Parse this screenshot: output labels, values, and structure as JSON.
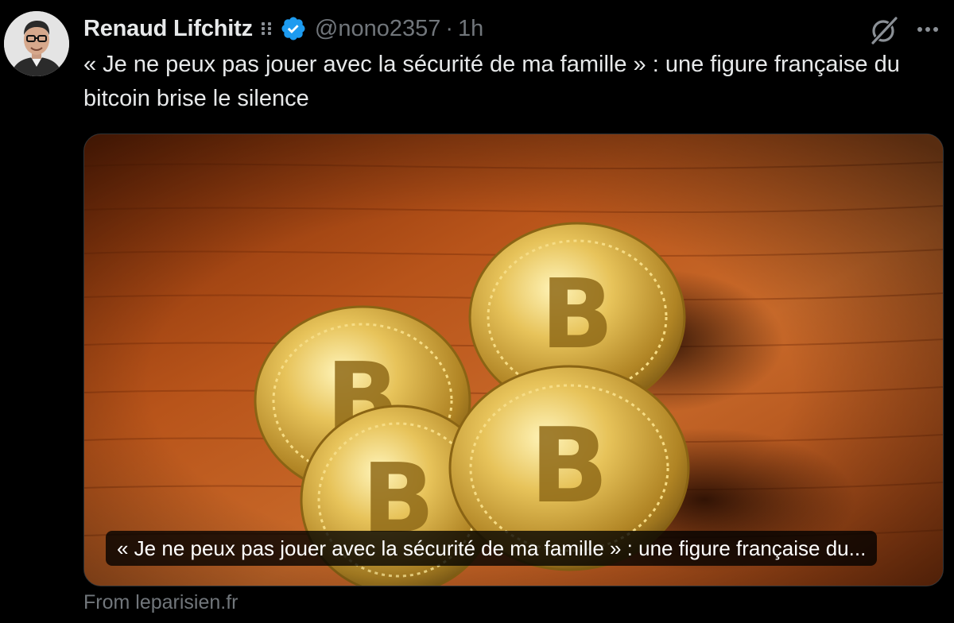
{
  "tweet": {
    "author": {
      "display_name": "Renaud Lifchitz",
      "handle": "@nono2357",
      "verified": true,
      "avatar_icon": "user-portrait-avatar"
    },
    "separator": "·",
    "timestamp": "1h",
    "text": "« Je ne peux pas jouer avec la sécurité de ma famille » : une figure française du bitcoin brise le silence",
    "card": {
      "image_icon": "bitcoin-coins-photo",
      "title": "« Je ne peux pas jouer avec la sécurité de ma famille » : une figure française du..."
    },
    "source_label": "From leparisien.fr"
  },
  "icons": {
    "affiliate": "grid-dots-icon",
    "verified": "verified-badge-icon",
    "grok": "grok-icon",
    "more": "more-options-icon"
  },
  "colors": {
    "background": "#000000",
    "text_primary": "#e7e9ea",
    "text_secondary": "#71767b",
    "verified_blue": "#1d9bf0",
    "border": "#2f3336"
  }
}
